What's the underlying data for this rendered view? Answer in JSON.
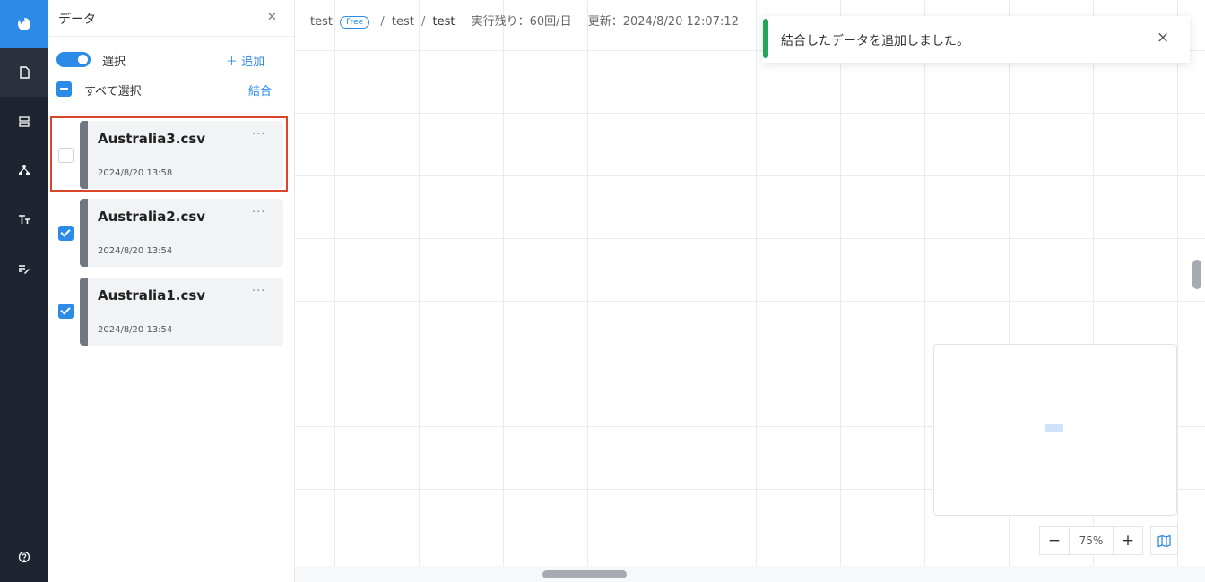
{
  "panel": {
    "title": "データ",
    "close_icon": "close-icon",
    "select_label": "選択",
    "add_label": "＋ 追加",
    "select_all_label": "すべて選択",
    "merge_label": "結合"
  },
  "files": [
    {
      "name": "Australia3.csv",
      "date": "2024/8/20 13:58",
      "checked": false,
      "highlighted": true
    },
    {
      "name": "Australia2.csv",
      "date": "2024/8/20 13:54",
      "checked": true,
      "highlighted": false
    },
    {
      "name": "Australia1.csv",
      "date": "2024/8/20 13:54",
      "checked": true,
      "highlighted": false
    }
  ],
  "more_label": "···",
  "breadcrumb": {
    "project": "test",
    "badge": "Free",
    "folder": "test",
    "current": "test",
    "runs_left": "実行残り：60回/日",
    "updated": "更新：2024/8/20 12:07:12"
  },
  "toast": {
    "message": "結合したデータを追加しました。",
    "close": "×",
    "status_color": "#25a55c"
  },
  "zoom": {
    "minus": "−",
    "value": "75%",
    "plus": "+"
  },
  "rail_icons": [
    "logo-icon",
    "document-icon",
    "database-icon",
    "network-icon",
    "text-format-icon",
    "edit-list-icon",
    "help-icon"
  ],
  "colors": {
    "accent": "#2c8be6",
    "rail": "#1f2530",
    "highlight": "#d9472b"
  }
}
